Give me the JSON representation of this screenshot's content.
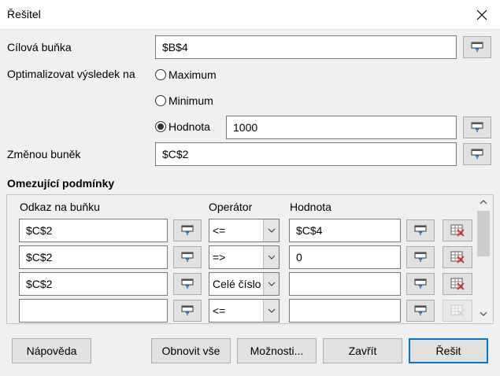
{
  "window": {
    "title": "Řešitel"
  },
  "target": {
    "label": "Cílová buňka",
    "value": "$B$4"
  },
  "optimize": {
    "label": "Optimalizovat výsledek na",
    "options": [
      {
        "label": "Maximum",
        "selected": false
      },
      {
        "label": "Minimum",
        "selected": false
      },
      {
        "label": "Hodnota",
        "selected": true
      }
    ],
    "value_field": "1000"
  },
  "changing": {
    "label": "Změnou buněk",
    "value": "$C$2"
  },
  "constraints": {
    "title": "Omezující podmínky",
    "headers": {
      "cell_ref": "Odkaz na buňku",
      "operator": "Operátor",
      "value": "Hodnota"
    },
    "rows": [
      {
        "cell_ref": "$C$2",
        "operator": "<=",
        "value": "$C$4",
        "delete_enabled": true
      },
      {
        "cell_ref": "$C$2",
        "operator": "=>",
        "value": "0",
        "delete_enabled": true
      },
      {
        "cell_ref": "$C$2",
        "operator": "Celé číslo",
        "value": "",
        "delete_enabled": true
      },
      {
        "cell_ref": "",
        "operator": "<=",
        "value": "",
        "delete_enabled": false
      }
    ]
  },
  "buttons": {
    "help": "Nápověda",
    "reset": "Obnovit vše",
    "options": "Možnosti...",
    "close": "Zavřít",
    "solve": "Řešit"
  }
}
